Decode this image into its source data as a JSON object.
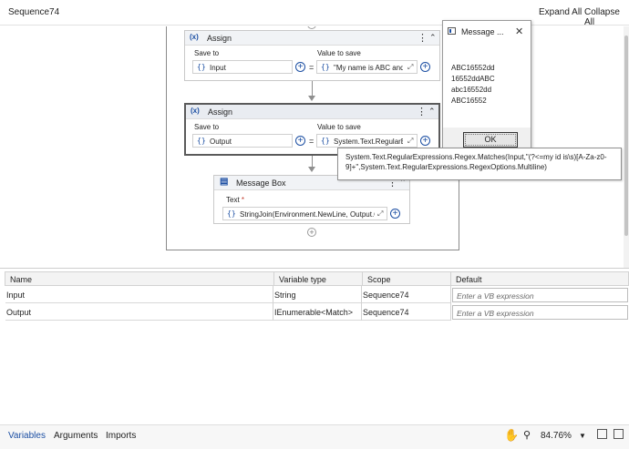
{
  "header": {
    "title": "Sequence74",
    "expand_all": "Expand All",
    "collapse_all": "Collapse All"
  },
  "assign1": {
    "title": "Assign",
    "icon": "(x)",
    "save_to_label": "Save to",
    "value_to_save_label": "Value to save",
    "save_to_value": "Input",
    "value_to_save_value": "\"My name is ABC and",
    "equals": "="
  },
  "assign2": {
    "title": "Assign",
    "icon": "(x)",
    "save_to_label": "Save to",
    "value_to_save_label": "Value to save",
    "save_to_value": "Output",
    "value_to_save_value": "System.Text.RegularExp",
    "equals": "="
  },
  "message_activity": {
    "title": "Message Box",
    "text_label": "Text",
    "required_mark": "*",
    "text_value": "StringJoin(Environment.NewLine, Output.C"
  },
  "dialog": {
    "title": "Message ...",
    "lines": [
      "ABC16552dd",
      "16552ddABC",
      "abc16552dd",
      "ABC16552"
    ],
    "ok_label": "OK"
  },
  "tooltip": {
    "text": "System.Text.RegularExpressions.Regex.Matches(Input,\"(?<=my id is\\s)[A-Za-z0-9]+\",System.Text.RegularExpressions.RegexOptions.Multiline)"
  },
  "variables": {
    "columns": [
      "Name",
      "Variable type",
      "Scope",
      "Default"
    ],
    "rows": [
      {
        "name": "Input",
        "type": "String",
        "scope": "Sequence74",
        "default_placeholder": "Enter a VB expression"
      },
      {
        "name": "Output",
        "type": "IEnumerable<Match>",
        "scope": "Sequence74",
        "default_placeholder": "Enter a VB expression"
      }
    ]
  },
  "bottom": {
    "tabs": [
      "Variables",
      "Arguments",
      "Imports"
    ],
    "zoom": "84.76%",
    "icons": [
      "hand-icon",
      "search-icon",
      "chevron-down-icon",
      "fit-screen-icon"
    ],
    "accent": "#1c4fa3"
  }
}
